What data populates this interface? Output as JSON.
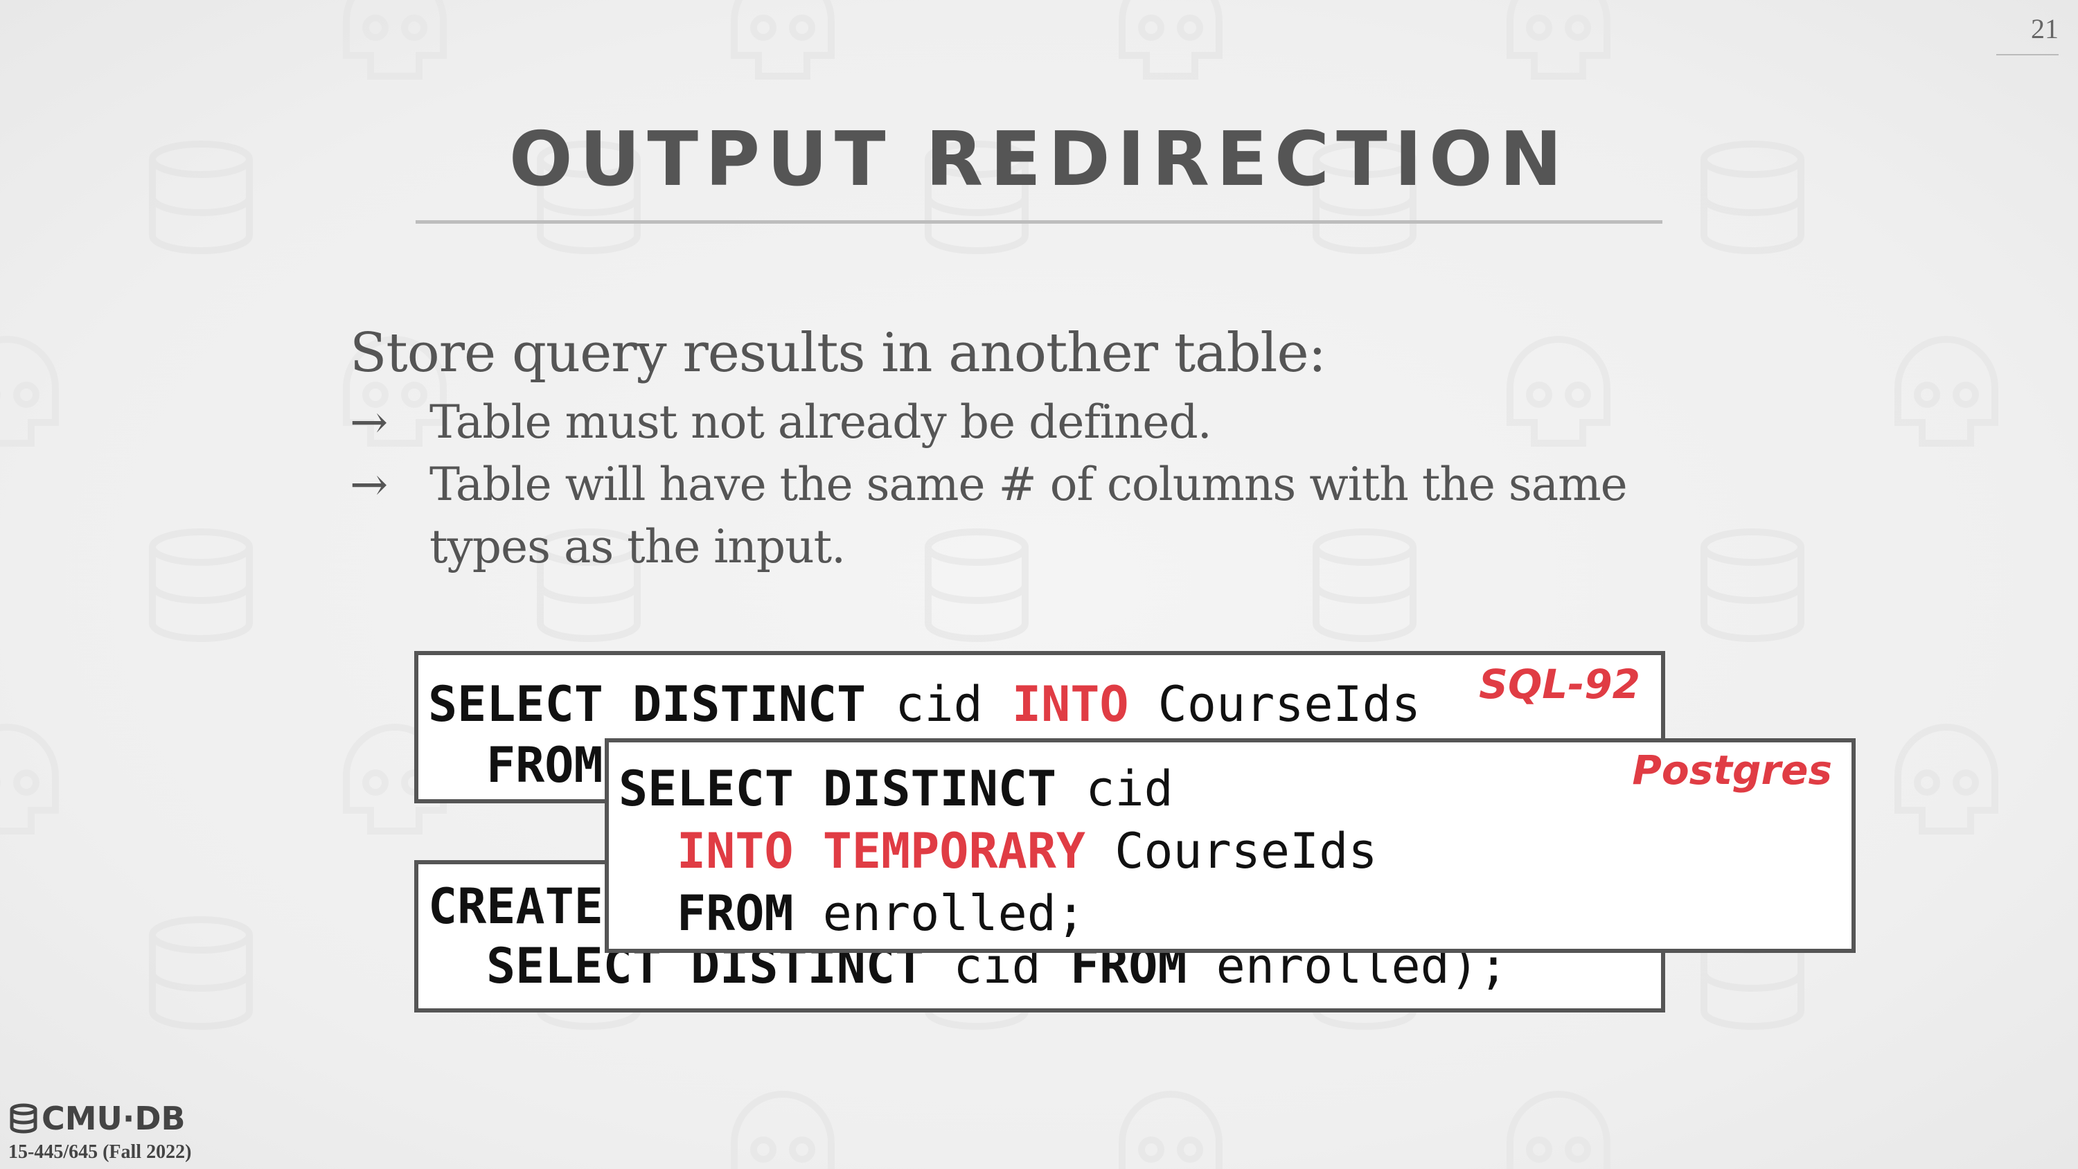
{
  "slide": {
    "number": "21"
  },
  "header": {
    "title": "OUTPUT REDIRECTION"
  },
  "content": {
    "lead": "Store query results in another table:",
    "bullets": [
      {
        "arrow": "→",
        "text": "Table must not already be defined."
      },
      {
        "arrow": "→",
        "text_line1": "Table will have the same # of columns with the same",
        "text_line2": "types as the input."
      }
    ]
  },
  "code_sql92": {
    "dialect": "SQL-92",
    "line1": {
      "k1": "SELECT",
      "k2": "DISTINCT",
      "t1": "cid",
      "r1": "INTO",
      "t2": "CourseIds"
    },
    "line2": {
      "k1": "FROM"
    }
  },
  "code_create": {
    "line1": {
      "k1": "CREATE"
    },
    "line2": {
      "k1": "SELECT",
      "k2": "DISTINCT",
      "t1": "cid",
      "k3": "FROM",
      "t2": "enrolled);"
    }
  },
  "code_postgres": {
    "dialect": "Postgres",
    "line1": {
      "k1": "SELECT",
      "k2": "DISTINCT",
      "t1": "cid"
    },
    "line2": {
      "r1": "INTO",
      "r2": "TEMPORARY",
      "t1": "CourseIds"
    },
    "line3": {
      "k1": "FROM",
      "t1": "enrolled;"
    }
  },
  "footer": {
    "logo_text": "CMU·DB",
    "logo_icon": "database-icon",
    "course": "15-445/645 (Fall 2022)"
  },
  "colors": {
    "accent_red": "#e03c44",
    "text_gray": "#555555",
    "background": "#f0f0f0"
  }
}
